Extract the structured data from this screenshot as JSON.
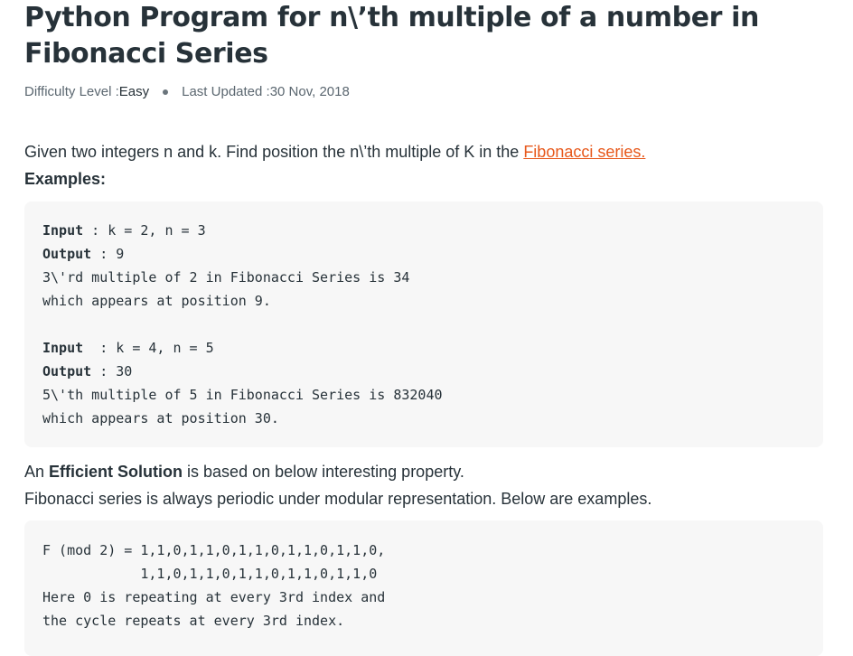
{
  "article": {
    "title": "Python Program for n\\’th multiple of a number in Fibonacci Series",
    "meta": {
      "difficulty_label": "Difficulty Level : ",
      "difficulty_value": "Easy",
      "updated_label": "Last Updated : ",
      "updated_value": "30 Nov, 2018"
    },
    "intro_text": "Given two integers n and k. Find position the n\\’th multiple of K in the ",
    "intro_link": "Fibonacci series.",
    "examples_heading": "Examples:",
    "example_block": {
      "line1_label": "Input",
      "line1_value": " : k = 2, n = 3",
      "line2_label": "Output",
      "line2_value": " : 9",
      "line3": "3\\'rd multiple of 2 in Fibonacci Series is 34",
      "line4": "which appears at position 9.",
      "line5_label": "Input",
      "line5_value": "  : k = 4, n = 5",
      "line6_label": "Output",
      "line6_value": " : 30",
      "line7": "5\\'th multiple of 5 in Fibonacci Series is 832040",
      "line8": "which appears at position 30."
    },
    "solution_prefix": "An ",
    "solution_bold": "Efficient Solution",
    "solution_suffix": " is based on below interesting property.",
    "periodic_text": "Fibonacci series is always periodic under modular representation. Below are examples.",
    "mod_block": {
      "line1": "F (mod 2) = 1,1,0,1,1,0,1,1,0,1,1,0,1,1,0,",
      "line2": "            1,1,0,1,1,0,1,1,0,1,1,0,1,1,0",
      "line3": "Here 0 is repeating at every 3rd index and",
      "line4": "the cycle repeats at every 3rd index."
    }
  }
}
